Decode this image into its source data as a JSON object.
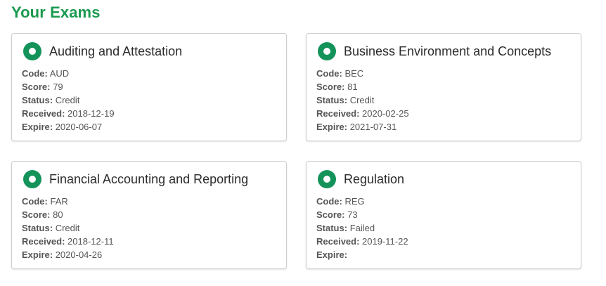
{
  "page": {
    "title": "Your Exams"
  },
  "labels": {
    "code": "Code:",
    "score": "Score:",
    "status": "Status:",
    "received": "Received:",
    "expire": "Expire:"
  },
  "colors": {
    "accent": "#1a9a4f",
    "icon": "#13935a"
  },
  "exams": [
    {
      "title": "Auditing and Attestation",
      "icon": "status-dot-icon",
      "code": "AUD",
      "score": "79",
      "status": "Credit",
      "received": "2018-12-19",
      "expire": "2020-06-07"
    },
    {
      "title": "Business Environment and Concepts",
      "icon": "status-dot-icon",
      "code": "BEC",
      "score": "81",
      "status": "Credit",
      "received": "2020-02-25",
      "expire": "2021-07-31"
    },
    {
      "title": "Financial Accounting and Reporting",
      "icon": "status-dot-icon",
      "code": "FAR",
      "score": "80",
      "status": "Credit",
      "received": "2018-12-11",
      "expire": "2020-04-26"
    },
    {
      "title": "Regulation",
      "icon": "status-dot-icon",
      "code": "REG",
      "score": "73",
      "status": "Failed",
      "received": "2019-11-22",
      "expire": ""
    }
  ]
}
